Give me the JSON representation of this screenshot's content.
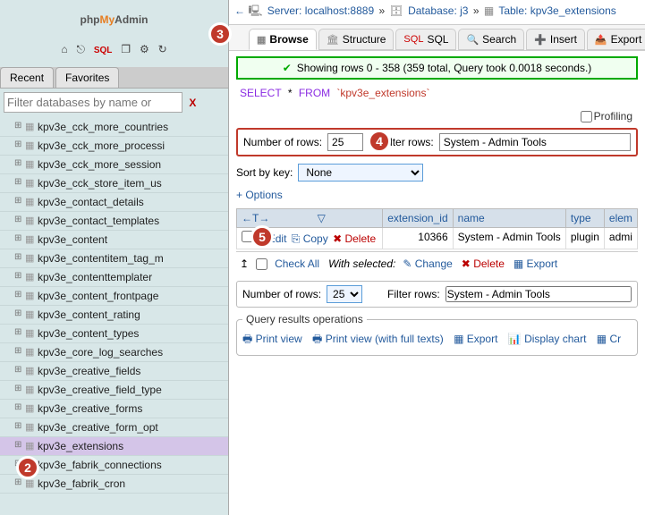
{
  "logo": {
    "php": "php",
    "my": "My",
    "admin": "Admin"
  },
  "sidebar_tabs": {
    "recent": "Recent",
    "favorites": "Favorites"
  },
  "filter": {
    "placeholder": "Filter databases by name or",
    "clear": "X"
  },
  "tables": [
    "kpv3e_cck_more_countries",
    "kpv3e_cck_more_processi",
    "kpv3e_cck_more_session",
    "kpv3e_cck_store_item_us",
    "kpv3e_contact_details",
    "kpv3e_contact_templates",
    "kpv3e_content",
    "kpv3e_contentitem_tag_m",
    "kpv3e_contenttemplater",
    "kpv3e_content_frontpage",
    "kpv3e_content_rating",
    "kpv3e_content_types",
    "kpv3e_core_log_searches",
    "kpv3e_creative_fields",
    "kpv3e_creative_field_type",
    "kpv3e_creative_forms",
    "kpv3e_creative_form_opt",
    "kpv3e_extensions",
    "kpv3e_fabrik_connections",
    "kpv3e_fabrik_cron"
  ],
  "selected_table": "kpv3e_extensions",
  "breadcrumb": {
    "server_label": "Server:",
    "server": "localhost:8889",
    "db_label": "Database:",
    "db": "j3",
    "table_label": "Table:",
    "table": "kpv3e_extensions"
  },
  "maintabs": {
    "browse": "Browse",
    "structure": "Structure",
    "sql": "SQL",
    "search": "Search",
    "insert": "Insert",
    "export": "Export"
  },
  "success": "Showing rows 0 - 358 (359 total, Query took 0.0018 seconds.)",
  "sql": {
    "select": "SELECT",
    "star": "*",
    "from": "FROM",
    "table": "`kpv3e_extensions`"
  },
  "profiling": "Profiling",
  "rowfilter": {
    "num_label": "Number of rows:",
    "num_value": "25",
    "filter_label": "Filter rows:",
    "filter_value": "System - Admin Tools"
  },
  "sortby": {
    "label": "Sort by key:",
    "value": "None"
  },
  "options": "+ Options",
  "columns": {
    "ext_id": "extension_id",
    "name": "name",
    "type": "type",
    "elem": "elem"
  },
  "row": {
    "edit": "Edit",
    "copy": "Copy",
    "delete": "Delete",
    "ext_id": "10366",
    "name": "System - Admin Tools",
    "type": "plugin",
    "elem": "admi"
  },
  "checkall": {
    "label": "Check All",
    "with": "With selected:",
    "change": "Change",
    "delete": "Delete",
    "export": "Export"
  },
  "ops": {
    "legend": "Query results operations",
    "print": "Print view",
    "print_full": "Print view (with full texts)",
    "export": "Export",
    "chart": "Display chart",
    "create": "Cr"
  },
  "badges": {
    "b2": "2",
    "b3": "3",
    "b4": "4",
    "b5": "5"
  }
}
